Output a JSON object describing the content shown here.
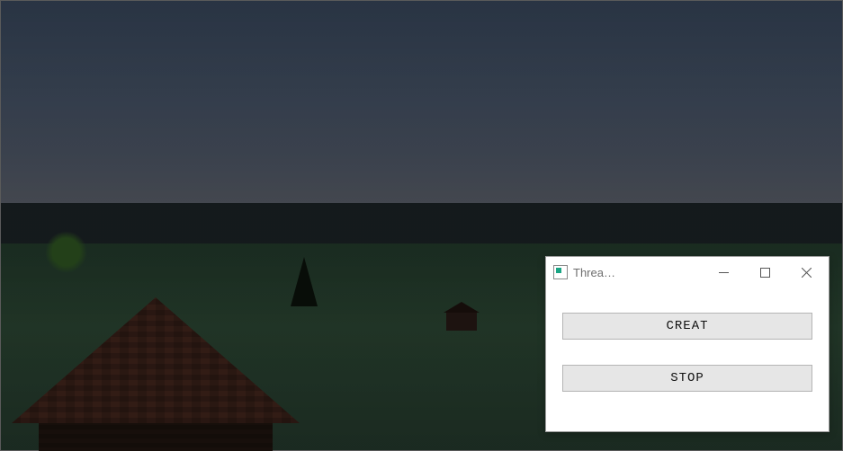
{
  "window": {
    "title": "Threa…",
    "buttons": {
      "create_label": "CREAT",
      "stop_label": "STOP"
    }
  }
}
